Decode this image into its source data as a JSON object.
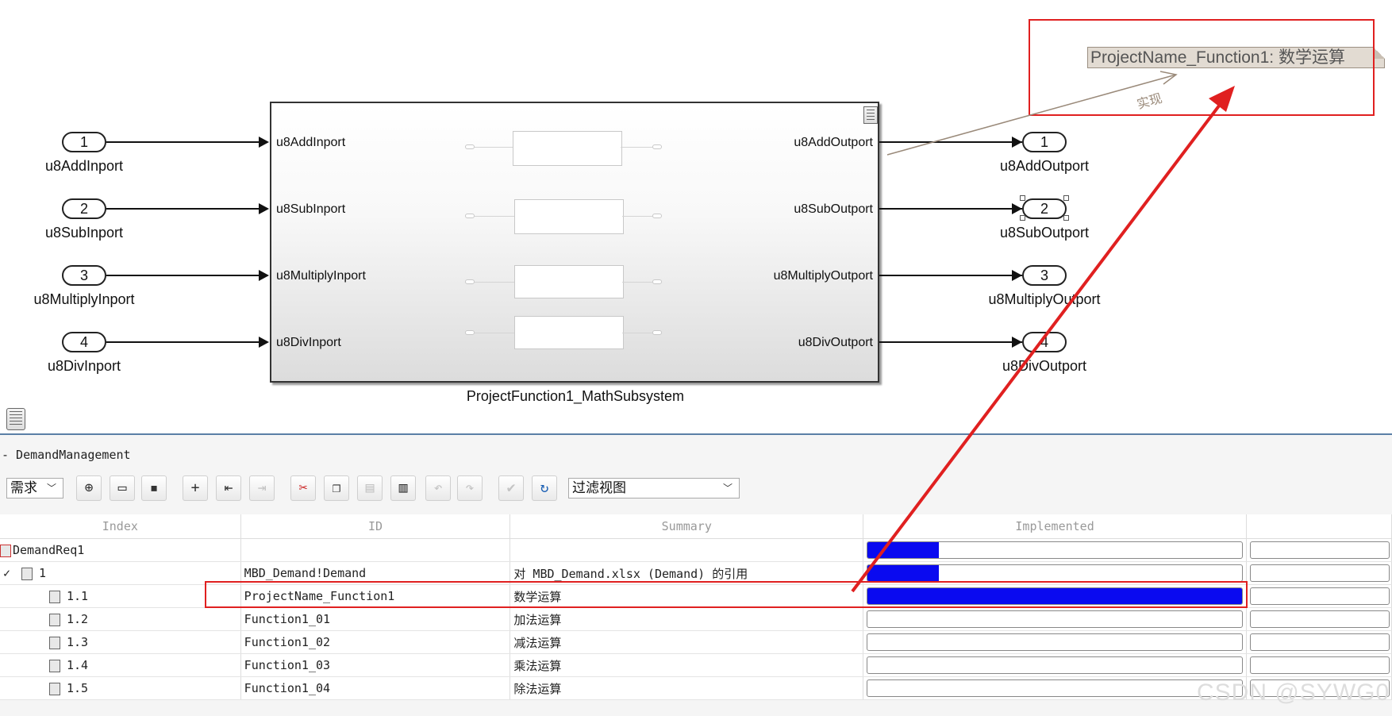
{
  "canvas": {
    "inports": [
      {
        "num": "1",
        "label": "u8AddInport"
      },
      {
        "num": "2",
        "label": "u8SubInport"
      },
      {
        "num": "3",
        "label": "u8MultiplyInport"
      },
      {
        "num": "4",
        "label": "u8DivInport"
      }
    ],
    "outports": [
      {
        "num": "1",
        "label": "u8AddOutport"
      },
      {
        "num": "2",
        "label": "u8SubOutport"
      },
      {
        "num": "3",
        "label": "u8MultiplyOutport"
      },
      {
        "num": "4",
        "label": "u8DivOutport"
      }
    ],
    "subsystem": {
      "name": "ProjectFunction1_MathSubsystem",
      "in_ports": [
        "u8AddInport",
        "u8SubInport",
        "u8MultiplyInport",
        "u8DivInport"
      ],
      "out_ports": [
        "u8AddOutport",
        "u8SubOutport",
        "u8MultiplyOutport",
        "u8DivOutport"
      ]
    },
    "annotation": "ProjectName_Function1: 数学运算",
    "link_label": "实现"
  },
  "panel": {
    "title": "- DemandManagement",
    "view_select": "需求",
    "filter_select": "过滤视图",
    "columns": [
      "Index",
      "ID",
      "Summary",
      "Implemented"
    ],
    "rows": [
      {
        "index": "DemandReq1",
        "id": "",
        "summary": "",
        "implemented": 0.19
      },
      {
        "index": "1",
        "id": "MBD_Demand!Demand",
        "summary": "对 MBD_Demand.xlsx (Demand) 的引用",
        "implemented": 0.19
      },
      {
        "index": "1.1",
        "id": "ProjectName_Function1",
        "summary": "数学运算",
        "implemented": 1.0
      },
      {
        "index": "1.2",
        "id": "Function1_01",
        "summary": "加法运算",
        "implemented": 0
      },
      {
        "index": "1.3",
        "id": "Function1_02",
        "summary": "减法运算",
        "implemented": 0
      },
      {
        "index": "1.4",
        "id": "Function1_03",
        "summary": "乘法运算",
        "implemented": 0
      },
      {
        "index": "1.5",
        "id": "Function1_04",
        "summary": "除法运算",
        "implemented": 0
      }
    ]
  },
  "colors": {
    "accent_red": "#e02020",
    "bar_blue": "#0a0af0"
  },
  "watermark": "CSDN @SYWG0"
}
